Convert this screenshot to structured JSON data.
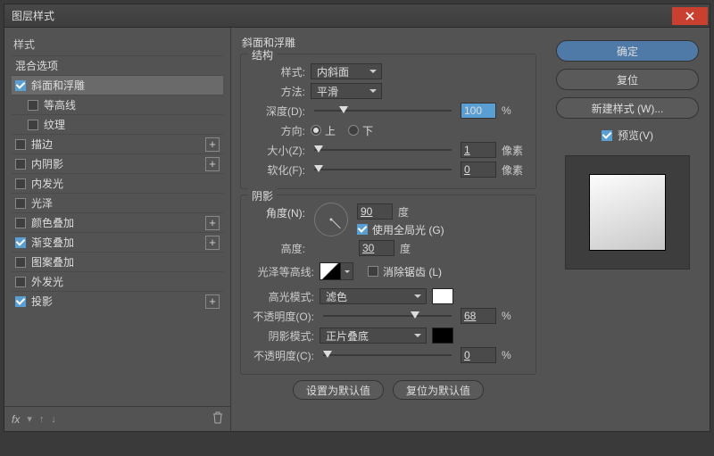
{
  "window": {
    "title": "图层样式"
  },
  "left": {
    "h_styles": "样式",
    "h_blend": "混合选项",
    "items": [
      {
        "label": "斜面和浮雕",
        "checked": true,
        "selected": true,
        "plus": false,
        "indent": 0
      },
      {
        "label": "等高线",
        "checked": false,
        "plus": false,
        "indent": 1
      },
      {
        "label": "纹理",
        "checked": false,
        "plus": false,
        "indent": 1
      },
      {
        "label": "描边",
        "checked": false,
        "plus": true,
        "indent": 0
      },
      {
        "label": "内阴影",
        "checked": false,
        "plus": true,
        "indent": 0
      },
      {
        "label": "内发光",
        "checked": false,
        "plus": false,
        "indent": 0
      },
      {
        "label": "光泽",
        "checked": false,
        "plus": false,
        "indent": 0
      },
      {
        "label": "颜色叠加",
        "checked": false,
        "plus": true,
        "indent": 0
      },
      {
        "label": "渐变叠加",
        "checked": true,
        "plus": true,
        "indent": 0
      },
      {
        "label": "图案叠加",
        "checked": false,
        "plus": false,
        "indent": 0
      },
      {
        "label": "外发光",
        "checked": false,
        "plus": false,
        "indent": 0
      },
      {
        "label": "投影",
        "checked": true,
        "plus": true,
        "indent": 0
      }
    ],
    "fx": "fx"
  },
  "mid": {
    "title": "斜面和浮雕",
    "structure": {
      "legend": "结构",
      "style_lbl": "样式:",
      "style_val": "内斜面",
      "method_lbl": "方法:",
      "method_val": "平滑",
      "depth_lbl": "深度(D):",
      "depth_val": "100",
      "depth_unit": "%",
      "dir_lbl": "方向:",
      "up": "上",
      "down": "下",
      "size_lbl": "大小(Z):",
      "size_val": "1",
      "size_unit": "像素",
      "soft_lbl": "软化(F):",
      "soft_val": "0",
      "soft_unit": "像素"
    },
    "shadow": {
      "legend": "阴影",
      "angle_lbl": "角度(N):",
      "angle_val": "90",
      "deg": "度",
      "global": "使用全局光 (G)",
      "alt_lbl": "高度:",
      "alt_val": "30",
      "contour_lbl": "光泽等高线:",
      "aa": "消除锯齿 (L)",
      "hi_mode_lbl": "高光模式:",
      "hi_mode_val": "滤色",
      "hi_op_lbl": "不透明度(O):",
      "hi_op_val": "68",
      "pct": "%",
      "sh_mode_lbl": "阴影模式:",
      "sh_mode_val": "正片叠底",
      "sh_op_lbl": "不透明度(C):",
      "sh_op_val": "0"
    },
    "btn_default": "设置为默认值",
    "btn_reset": "复位为默认值"
  },
  "right": {
    "ok": "确定",
    "reset": "复位",
    "newstyle": "新建样式 (W)...",
    "preview": "预览(V)"
  }
}
